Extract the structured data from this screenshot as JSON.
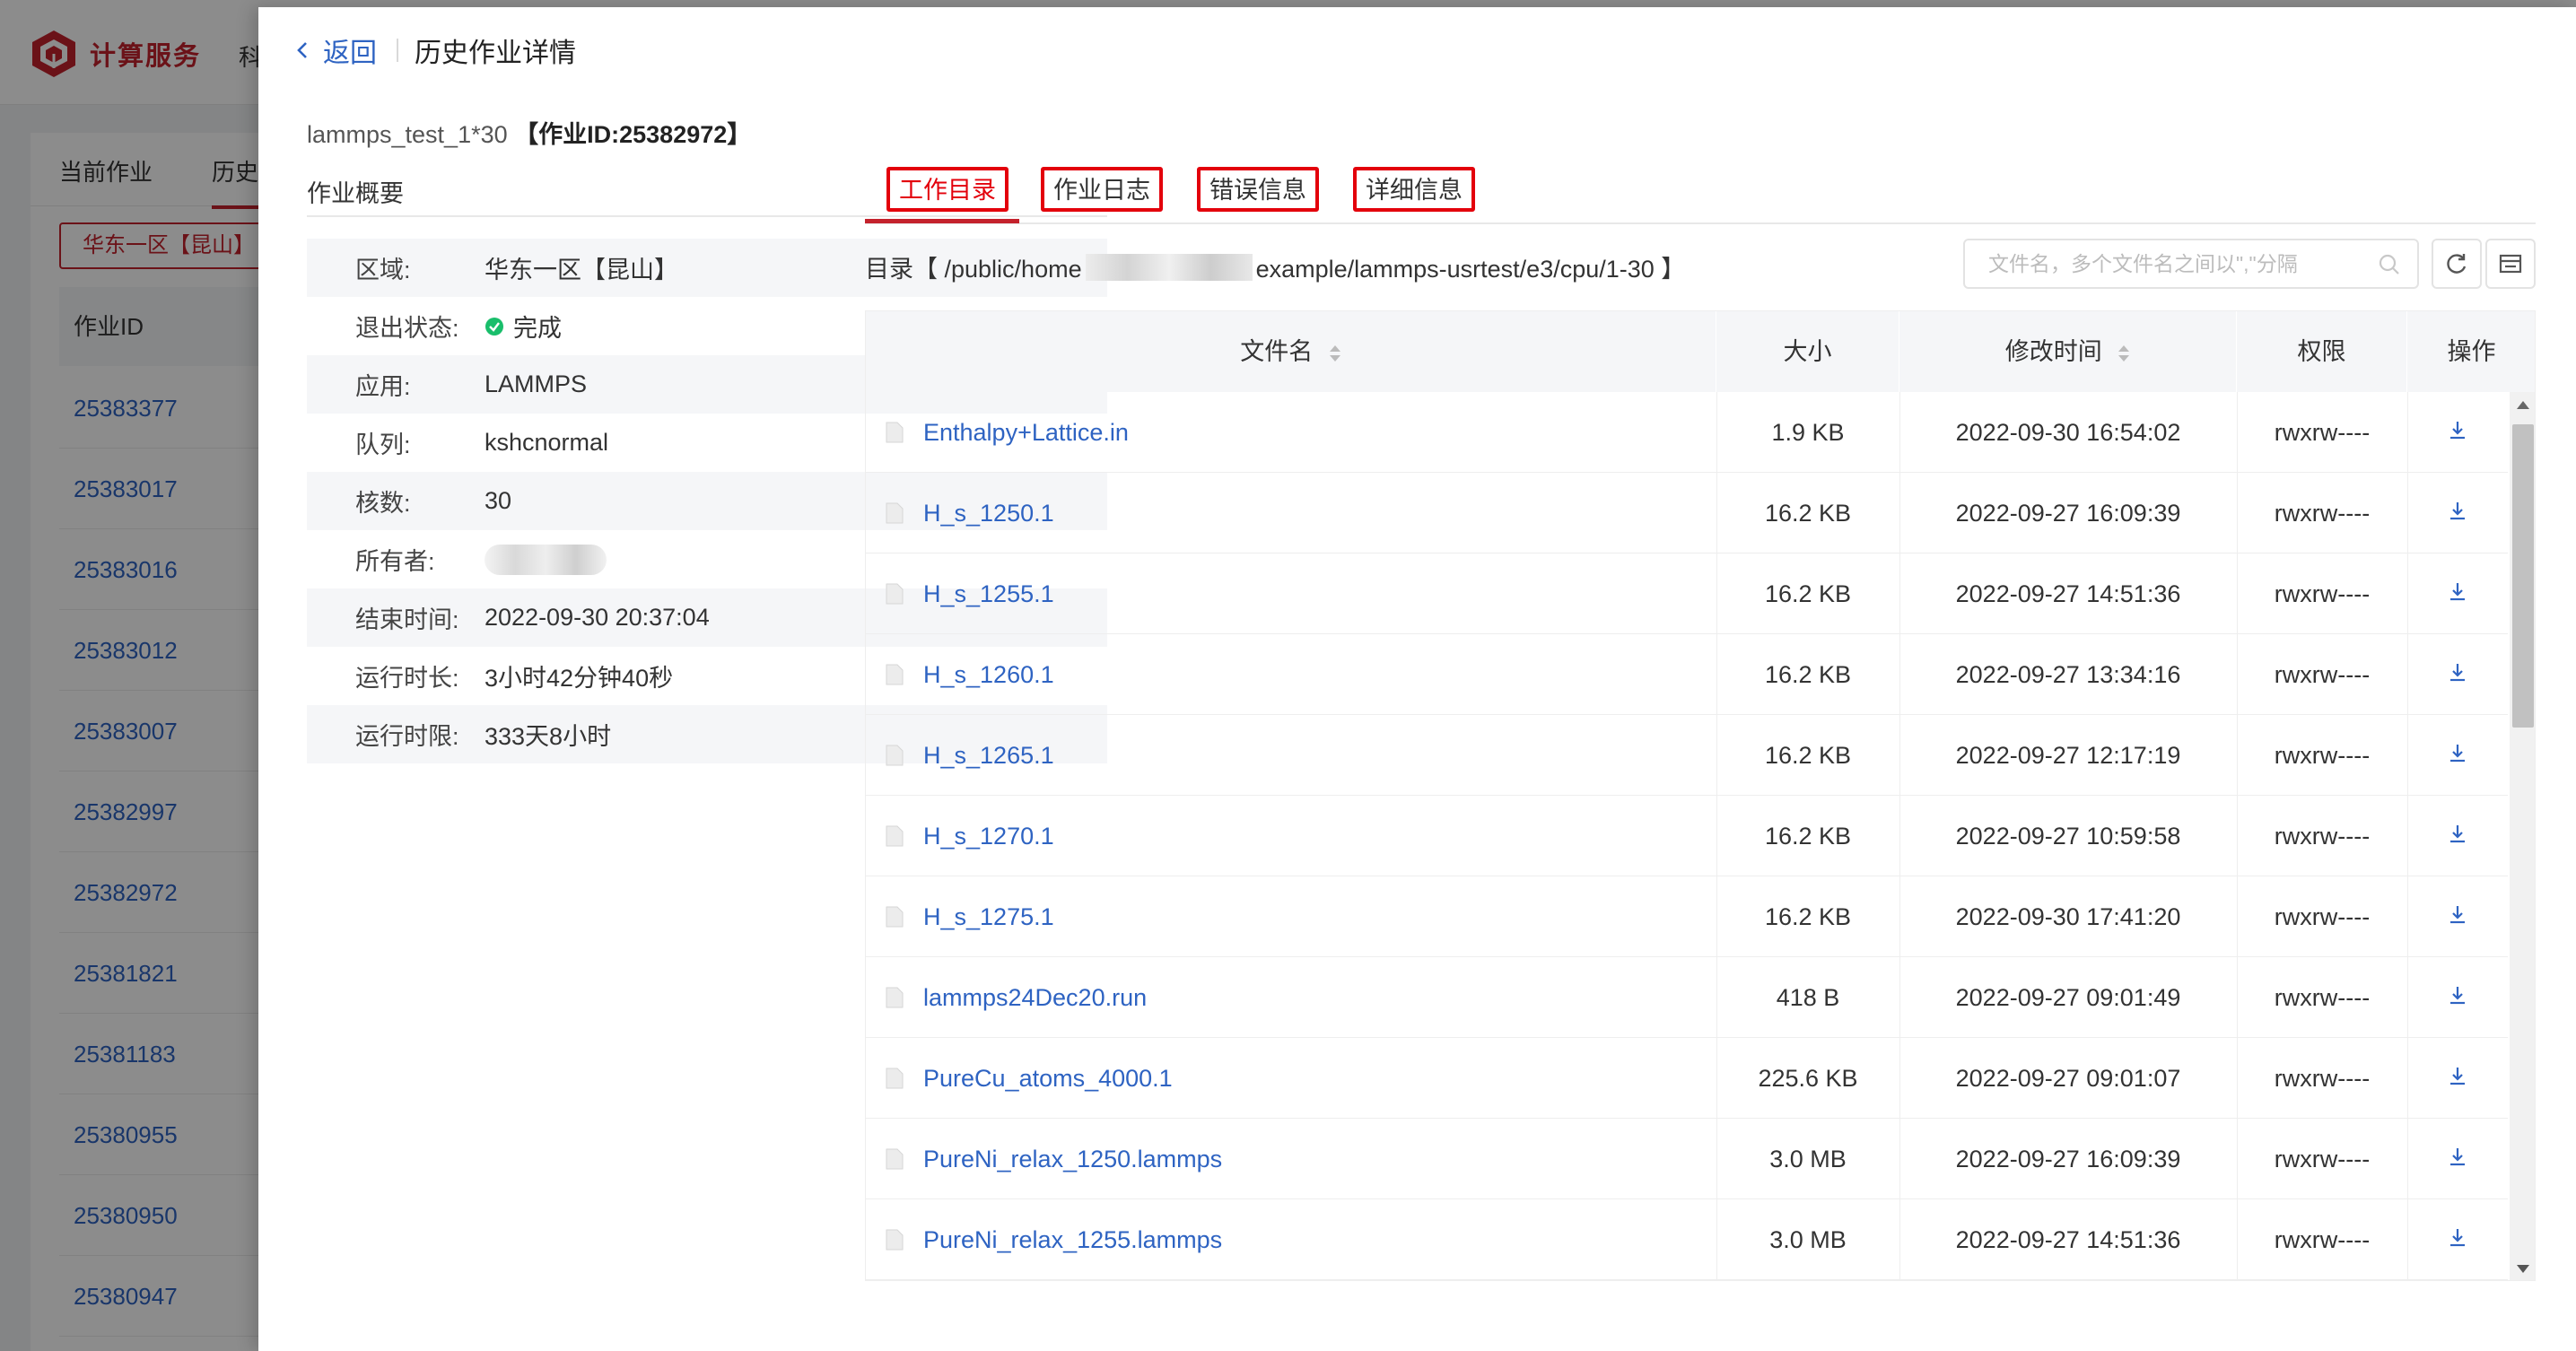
{
  "app": {
    "brand": "计算服务",
    "nav_peek": "科",
    "tabs": [
      "当前作业",
      "历史"
    ],
    "region_button": "华东一区【昆山】",
    "table_header": "作业ID",
    "job_ids": [
      "25383377",
      "25383017",
      "25383016",
      "25383012",
      "25383007",
      "25382997",
      "25382972",
      "25381821",
      "25381183",
      "25380955",
      "25380950",
      "25380947"
    ],
    "brand_color": "#c4222c"
  },
  "drawer": {
    "back_label": "返回",
    "title": "历史作业详情",
    "job_name": "lammps_test_1*30",
    "job_id_text": "【作业ID:25382972】",
    "summary_label": "作业概要",
    "summary": [
      {
        "key": "区域:",
        "value": "华东一区【昆山】"
      },
      {
        "key": "退出状态:",
        "value": "完成",
        "icon": "check-circle-icon"
      },
      {
        "key": "应用:",
        "value": "LAMMPS"
      },
      {
        "key": "队列:",
        "value": "kshcnormal"
      },
      {
        "key": "核数:",
        "value": "30"
      },
      {
        "key": "所有者:",
        "value": ""
      },
      {
        "key": "结束时间:",
        "value": "2022-09-30 20:37:04"
      },
      {
        "key": "运行时长:",
        "value": "3小时42分钟40秒"
      },
      {
        "key": "运行时限:",
        "value": "333天8小时"
      }
    ],
    "tabs": [
      "工作目录",
      "作业日志",
      "错误信息",
      "详细信息"
    ],
    "active_tab": "工作目录",
    "directory": {
      "prefix": "目录【 /public/home",
      "suffix": "example/lammps-usrtest/e3/cpu/1-30 】"
    },
    "search": {
      "placeholder": "文件名，多个文件名之间以\",\"分隔",
      "value": ""
    },
    "columns": {
      "name": "文件名",
      "size": "大小",
      "mtime": "修改时间",
      "perm": "权限",
      "action": "操作"
    },
    "files": [
      {
        "name": "Enthalpy+Lattice.in",
        "size": "1.9 KB",
        "mtime": "2022-09-30 16:54:02",
        "perm": "rwxrw----"
      },
      {
        "name": "H_s_1250.1",
        "size": "16.2 KB",
        "mtime": "2022-09-27 16:09:39",
        "perm": "rwxrw----"
      },
      {
        "name": "H_s_1255.1",
        "size": "16.2 KB",
        "mtime": "2022-09-27 14:51:36",
        "perm": "rwxrw----"
      },
      {
        "name": "H_s_1260.1",
        "size": "16.2 KB",
        "mtime": "2022-09-27 13:34:16",
        "perm": "rwxrw----"
      },
      {
        "name": "H_s_1265.1",
        "size": "16.2 KB",
        "mtime": "2022-09-27 12:17:19",
        "perm": "rwxrw----"
      },
      {
        "name": "H_s_1270.1",
        "size": "16.2 KB",
        "mtime": "2022-09-27 10:59:58",
        "perm": "rwxrw----"
      },
      {
        "name": "H_s_1275.1",
        "size": "16.2 KB",
        "mtime": "2022-09-30 17:41:20",
        "perm": "rwxrw----"
      },
      {
        "name": "lammps24Dec20.run",
        "size": "418 B",
        "mtime": "2022-09-27 09:01:49",
        "perm": "rwxrw----"
      },
      {
        "name": "PureCu_atoms_4000.1",
        "size": "225.6 KB",
        "mtime": "2022-09-27 09:01:07",
        "perm": "rwxrw----"
      },
      {
        "name": "PureNi_relax_1250.lammps",
        "size": "3.0 MB",
        "mtime": "2022-09-27 16:09:39",
        "perm": "rwxrw----"
      },
      {
        "name": "PureNi_relax_1255.lammps",
        "size": "3.0 MB",
        "mtime": "2022-09-27 14:51:36",
        "perm": "rwxrw----"
      }
    ],
    "colors": {
      "link": "#2e63c2",
      "highlight_box": "#e3000b",
      "success": "#19be6b"
    }
  }
}
